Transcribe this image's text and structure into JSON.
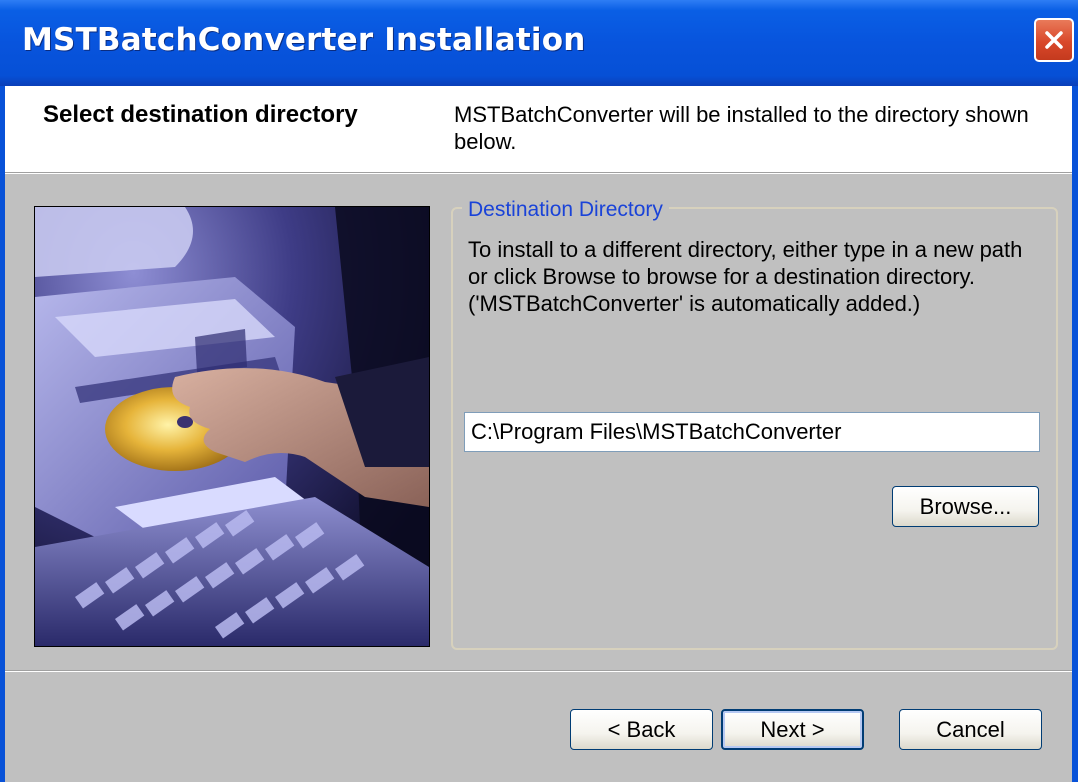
{
  "window": {
    "title": "MSTBatchConverter Installation",
    "close_icon": "close-icon"
  },
  "header": {
    "title": "Select destination directory",
    "description": "MSTBatchConverter will be installed to the directory shown below."
  },
  "destination_group": {
    "legend": "Destination Directory",
    "instructions": "To install to a different directory, either type in a new path or click Browse to browse for a destination directory. ('MSTBatchConverter' is automatically added.)",
    "path_value": "C:\\Program Files\\MSTBatchConverter",
    "browse_label": "Browse..."
  },
  "footer": {
    "back_label": "< Back",
    "next_label": "Next >",
    "cancel_label": "Cancel"
  },
  "colors": {
    "titlebar": "#0854dd",
    "legend_text": "#1a43d8",
    "panel_background": "#c0c0c0"
  }
}
